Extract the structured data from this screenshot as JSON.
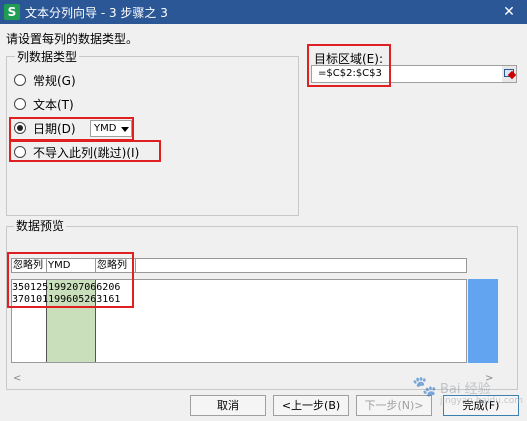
{
  "window": {
    "title": "文本分列向导 - 3 步骤之 3",
    "app_icon_glyph": "S",
    "close_glyph": "✕"
  },
  "instruction": "请设置每列的数据类型。",
  "column_type": {
    "legend": "列数据类型",
    "options": [
      {
        "label": "常规(G)",
        "selected": false
      },
      {
        "label": "文本(T)",
        "selected": false
      },
      {
        "label": "日期(D)",
        "selected": true
      },
      {
        "label": "不导入此列(跳过)(I)",
        "selected": false
      }
    ],
    "date_format": "YMD"
  },
  "target_area": {
    "label": "目标区域(E):",
    "value": "=$C$2:$C$3",
    "button_icon": "collapse-dialog-icon"
  },
  "preview": {
    "legend": "数据预览",
    "headers": [
      "忽略列",
      "YMD",
      "忽略列"
    ],
    "rows": [
      "350125199207066206",
      "370101199605263161"
    ],
    "scroll_left": "<",
    "scroll_right": ">"
  },
  "buttons": {
    "cancel": "取消",
    "back": "<上一步(B)",
    "next": "下一步(N)>",
    "finish": "完成(F)"
  },
  "watermark": {
    "text": "Bai 经验",
    "sub": "jingyan.baidu.com"
  },
  "colors": {
    "titlebar": "#2b5797",
    "highlight": "#e02020",
    "date_column": "#c9dfbb",
    "scrollbar": "#63a4f0"
  }
}
